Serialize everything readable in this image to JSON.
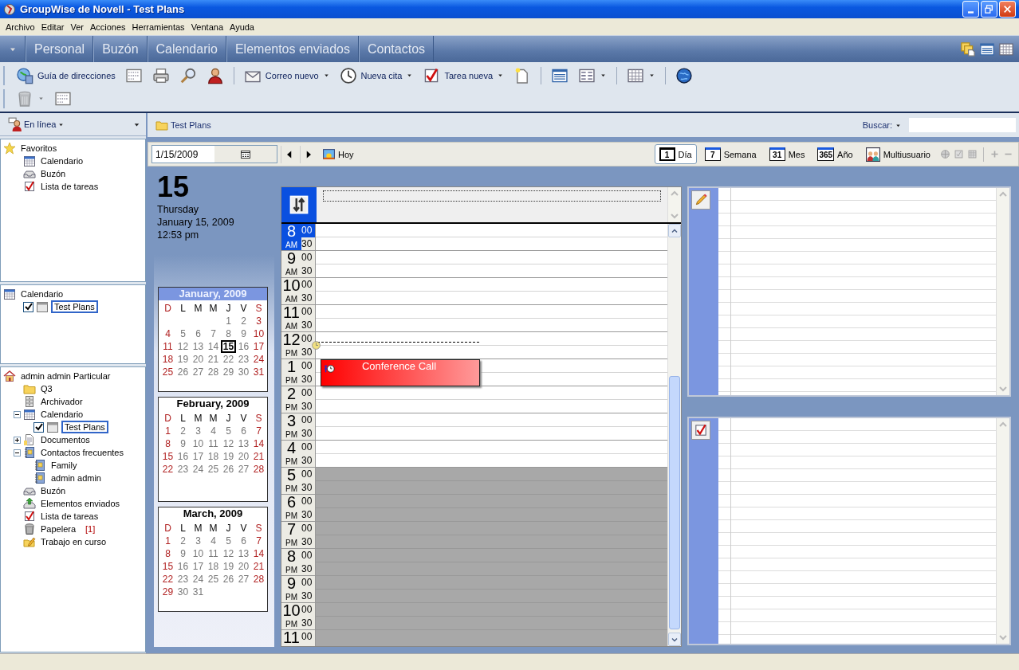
{
  "window": {
    "title": "GroupWise de Novell - Test Plans"
  },
  "menu_bar": [
    "Archivo",
    "Editar",
    "Ver",
    "Acciones",
    "Herramientas",
    "Ventana",
    "Ayuda"
  ],
  "nav_tabs": [
    "Personal",
    "Buzón",
    "Calendario",
    "Elementos enviados",
    "Contactos"
  ],
  "toolbar": {
    "rows": [
      [
        {
          "kind": "address_book",
          "label": "Guía de direcciones"
        },
        {
          "kind": "form"
        },
        {
          "kind": "printer"
        },
        {
          "kind": "find"
        },
        {
          "kind": "proxy"
        },
        {
          "kind": "separator"
        },
        {
          "kind": "mail",
          "label": "Correo nuevo",
          "menu": true
        },
        {
          "kind": "appointment",
          "label": "Nueva cita",
          "menu": true
        },
        {
          "kind": "task",
          "label": "Tarea nueva",
          "menu": true
        },
        {
          "kind": "new_document"
        },
        {
          "kind": "separator"
        },
        {
          "kind": "list"
        },
        {
          "kind": "columns",
          "menu": true
        },
        {
          "kind": "separator"
        },
        {
          "kind": "table",
          "menu": true
        },
        {
          "kind": "separator"
        },
        {
          "kind": "help"
        }
      ],
      [
        {
          "kind": "trash",
          "menu": true,
          "disabled": true
        },
        {
          "kind": "form"
        }
      ]
    ]
  },
  "sidebar": {
    "status": "En línea",
    "favorites": [
      {
        "kind": "favorites",
        "label": "Favoritos",
        "selected": false,
        "children": [
          {
            "kind": "calendar",
            "label": "Calendario",
            "selected": false
          },
          {
            "kind": "mailbox",
            "label": "Buzón",
            "selected": false
          },
          {
            "kind": "tasks",
            "label": "Lista de tareas",
            "selected": false
          }
        ]
      }
    ],
    "calendars": [
      {
        "kind": "calendar",
        "label": "Calendario",
        "selected": false,
        "children": [
          {
            "kind": "subcalendar",
            "label": "Test Plans",
            "checked": true,
            "selected": true
          }
        ]
      }
    ],
    "folders": [
      {
        "kind": "home",
        "label": "admin admin Particular",
        "selected": false,
        "children": [
          {
            "kind": "folder",
            "label": "Q3",
            "selected": false
          },
          {
            "kind": "cabinet",
            "label": "Archivador",
            "selected": false
          },
          {
            "kind": "calendar",
            "label": "Calendario",
            "expanded": true,
            "selected": false,
            "children": [
              {
                "kind": "subcalendar",
                "label": "Test Plans",
                "checked": true,
                "selected": true
              }
            ]
          },
          {
            "kind": "documents",
            "label": "Documentos",
            "expanded": false,
            "selected": false
          },
          {
            "kind": "contacts",
            "label": "Contactos frecuentes",
            "expanded": true,
            "selected": false,
            "children": [
              {
                "kind": "contacts",
                "label": "Family",
                "selected": false
              },
              {
                "kind": "contacts",
                "label": "admin admin",
                "selected": false
              }
            ]
          },
          {
            "kind": "mailbox",
            "label": "Buzón",
            "selected": false
          },
          {
            "kind": "sent",
            "label": "Elementos enviados",
            "selected": false
          },
          {
            "kind": "tasks",
            "label": "Lista de tareas",
            "selected": false
          },
          {
            "kind": "trash",
            "label": "Papelera",
            "count": "[1]",
            "selected": false
          },
          {
            "kind": "work",
            "label": "Trabajo en curso",
            "selected": false
          }
        ]
      }
    ]
  },
  "folder_path": "Test Plans",
  "search": {
    "label": "Buscar:"
  },
  "calendar_toolbar": {
    "date": "1/15/2009",
    "today": "Hoy",
    "views": [
      {
        "number": "1",
        "label": "Día",
        "selected": true
      },
      {
        "number": "7",
        "label": "Semana",
        "selected": false
      },
      {
        "number": "31",
        "label": "Mes",
        "selected": false
      },
      {
        "number": "365",
        "label": "Año",
        "selected": false
      },
      {
        "label": "Multiusuario",
        "selected": false
      }
    ]
  },
  "day_summary": {
    "day": "15",
    "weekday": "Thursday",
    "date": "January 15, 2009",
    "time": "12:53 pm"
  },
  "mini_months": [
    {
      "title": "January, 2009",
      "highlighted": true,
      "weekdays": [
        "D",
        "L",
        "M",
        "M",
        "J",
        "V",
        "S"
      ],
      "weeks": [
        [
          "1",
          "2",
          "3"
        ],
        [
          "4",
          "5",
          "6",
          "7",
          "8",
          "9",
          "10"
        ],
        [
          "11",
          "12",
          "13",
          "14",
          {
            "day": "15",
            "selected": true
          },
          "16",
          "17"
        ],
        [
          "18",
          "19",
          "20",
          "21",
          "22",
          "23",
          "24"
        ],
        [
          "25",
          "26",
          "27",
          "28",
          "29",
          "30",
          "31"
        ]
      ]
    },
    {
      "title": "February, 2009",
      "highlighted": false,
      "weekdays": [
        "D",
        "L",
        "M",
        "M",
        "J",
        "V",
        "S"
      ],
      "weeks": [
        [
          "1",
          "2",
          "3",
          "4",
          "5",
          "6",
          "7"
        ],
        [
          "8",
          "9",
          "10",
          "11",
          "12",
          "13",
          "14"
        ],
        [
          "15",
          "16",
          "17",
          "18",
          "19",
          "20",
          "21"
        ],
        [
          "22",
          "23",
          "24",
          "25",
          "26",
          "27",
          "28"
        ]
      ]
    },
    {
      "title": "March, 2009",
      "highlighted": false,
      "weekdays": [
        "D",
        "L",
        "M",
        "M",
        "J",
        "V",
        "S"
      ],
      "weeks": [
        [
          "1",
          "2",
          "3",
          "4",
          "5",
          "6",
          "7"
        ],
        [
          "8",
          "9",
          "10",
          "11",
          "12",
          "13",
          "14"
        ],
        [
          "15",
          "16",
          "17",
          "18",
          "19",
          "20",
          "21"
        ],
        [
          "22",
          "23",
          "24",
          "25",
          "26",
          "27",
          "28"
        ],
        [
          "29",
          "30",
          "31"
        ]
      ]
    }
  ],
  "day_view": {
    "hours": [
      {
        "hour": "8",
        "ampm": "AM",
        "minutes": [
          "00",
          "30"
        ],
        "current": true,
        "off_hours": false,
        "now_marker": false
      },
      {
        "hour": "9",
        "ampm": "AM",
        "minutes": [
          "00",
          "30"
        ],
        "current": false,
        "off_hours": false,
        "now_marker": false
      },
      {
        "hour": "10",
        "ampm": "AM",
        "minutes": [
          "00",
          "30"
        ],
        "current": false,
        "off_hours": false,
        "now_marker": false
      },
      {
        "hour": "11",
        "ampm": "AM",
        "minutes": [
          "00",
          "30"
        ],
        "current": false,
        "off_hours": false,
        "now_marker": false
      },
      {
        "hour": "12",
        "ampm": "PM",
        "minutes": [
          "00",
          "30"
        ],
        "current": false,
        "off_hours": false,
        "now_marker": true
      },
      {
        "hour": "1",
        "ampm": "PM",
        "minutes": [
          "00",
          "30"
        ],
        "current": false,
        "off_hours": false,
        "now_marker": false,
        "appointments": [
          {
            "title": "Conference Call"
          }
        ]
      },
      {
        "hour": "2",
        "ampm": "PM",
        "minutes": [
          "00",
          "30"
        ],
        "current": false,
        "off_hours": false,
        "now_marker": false
      },
      {
        "hour": "3",
        "ampm": "PM",
        "minutes": [
          "00",
          "30"
        ],
        "current": false,
        "off_hours": false,
        "now_marker": false
      },
      {
        "hour": "4",
        "ampm": "PM",
        "minutes": [
          "00",
          "30"
        ],
        "current": false,
        "off_hours": false,
        "now_marker": false
      },
      {
        "hour": "5",
        "ampm": "PM",
        "minutes": [
          "00",
          "30"
        ],
        "current": false,
        "off_hours": true,
        "now_marker": false
      },
      {
        "hour": "6",
        "ampm": "PM",
        "minutes": [
          "00",
          "30"
        ],
        "current": false,
        "off_hours": true,
        "now_marker": false
      },
      {
        "hour": "7",
        "ampm": "PM",
        "minutes": [
          "00",
          "30"
        ],
        "current": false,
        "off_hours": true,
        "now_marker": false
      },
      {
        "hour": "8",
        "ampm": "PM",
        "minutes": [
          "00",
          "30"
        ],
        "current": false,
        "off_hours": true,
        "now_marker": false
      },
      {
        "hour": "9",
        "ampm": "PM",
        "minutes": [
          "00",
          "30"
        ],
        "current": false,
        "off_hours": true,
        "now_marker": false
      },
      {
        "hour": "10",
        "ampm": "PM",
        "minutes": [
          "00",
          "30"
        ],
        "current": false,
        "off_hours": true,
        "now_marker": false
      },
      {
        "hour": "11",
        "minutes": [
          "00"
        ],
        "current": false,
        "off_hours": true,
        "now_marker": false
      }
    ]
  },
  "side_panels": [
    {
      "kind": "notes"
    },
    {
      "kind": "tasks"
    }
  ]
}
